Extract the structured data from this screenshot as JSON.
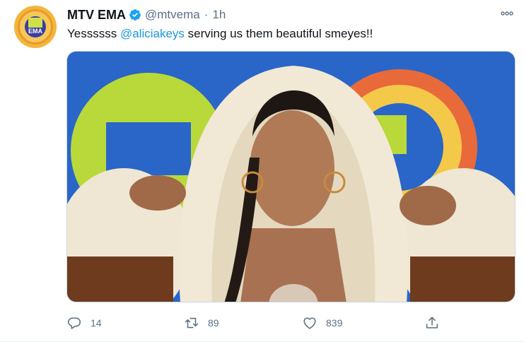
{
  "tweet": {
    "author_name": "MTV EMA",
    "handle": "@mtvema",
    "separator": "·",
    "time": "1h",
    "text_before": "Yessssss ",
    "mention": "@aliciakeys",
    "text_after": " serving us them beautiful smeyes!!",
    "avatar_label": "EMA"
  },
  "actions": {
    "replies": "14",
    "retweets": "89",
    "likes": "839"
  },
  "icons": {
    "verified": "verified-badge-icon",
    "more": "more-dots-icon",
    "reply": "reply-icon",
    "retweet": "retweet-icon",
    "like": "heart-icon",
    "share": "share-icon"
  },
  "colors": {
    "accent": "#1b95e0",
    "muted": "#5b7083",
    "text": "#0f1419",
    "photo_backdrop": "#2a66c8",
    "logo_green": "#b9d83a",
    "coat_cream": "#efe6d3",
    "coat_brown": "#6e3b1e"
  }
}
